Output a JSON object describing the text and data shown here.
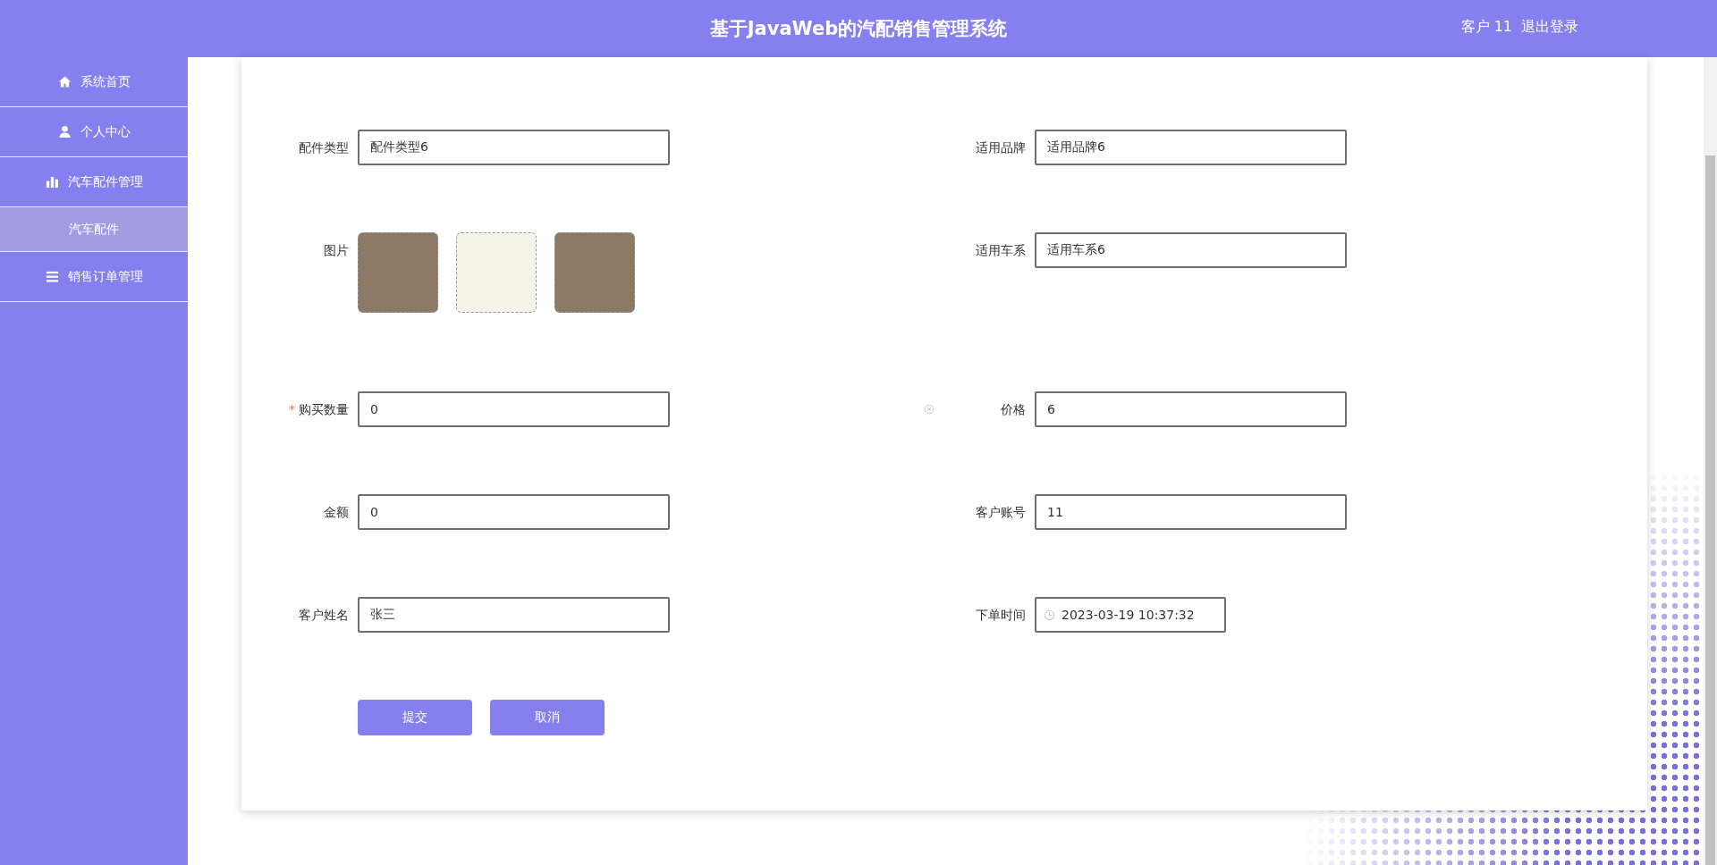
{
  "header": {
    "title": "基于JavaWeb的汽配销售管理系统",
    "user": "客户 11",
    "logout": "退出登录"
  },
  "sidebar": {
    "items": [
      {
        "label": "系统首页",
        "kind": "home",
        "selected": false
      },
      {
        "label": "个人中心",
        "kind": "user",
        "selected": false
      },
      {
        "label": "汽车配件管理",
        "kind": "chart",
        "selected": false,
        "expanded": true,
        "children": [
          {
            "label": "汽车配件",
            "selected": true
          }
        ]
      },
      {
        "label": "销售订单管理",
        "kind": "list",
        "selected": false
      }
    ]
  },
  "form": {
    "rows": [
      {
        "left": {
          "label": "配件类型",
          "kind": "text",
          "value": "配件类型6"
        },
        "right": {
          "label": "适用品牌",
          "kind": "text",
          "value": "适用品牌6"
        }
      },
      {
        "left": {
          "label": "图片",
          "kind": "images",
          "images": [
            {
              "color": "#8c7a66"
            },
            {
              "color": "#f5f2ea"
            },
            {
              "color": "#8c7a66"
            }
          ]
        },
        "right": {
          "label": "适用车系",
          "kind": "text",
          "value": "适用车系6"
        }
      },
      {
        "left": {
          "label": "购买数量",
          "kind": "number",
          "value": "0",
          "required_mark": "*"
        },
        "right": {
          "label": "价格",
          "kind": "text",
          "value": "6"
        }
      },
      {
        "left": {
          "label": "金额",
          "kind": "text",
          "value": "0"
        },
        "right": {
          "label": "客户账号",
          "kind": "text",
          "value": "11"
        }
      },
      {
        "left": {
          "label": "客户姓名",
          "kind": "text",
          "value": "张三"
        },
        "right": {
          "label": "下单时间",
          "kind": "datetime",
          "value": "2023-03-19 10:37:32"
        }
      }
    ],
    "buttons": [
      "提交",
      "取消"
    ]
  }
}
